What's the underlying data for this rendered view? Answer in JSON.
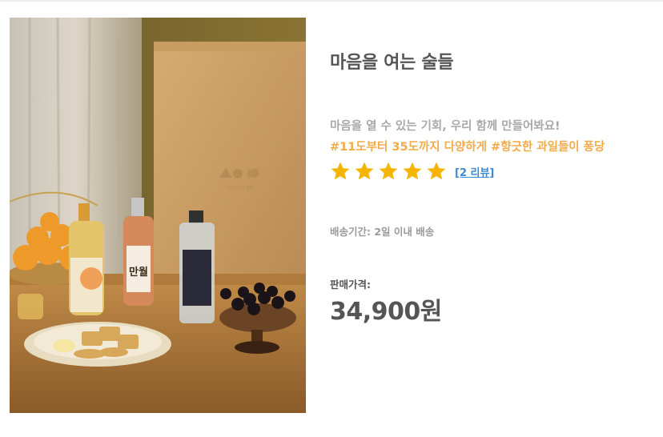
{
  "product": {
    "image_alt": "마음을 여는 술들",
    "box_logo_text": "마음을 여는 술들",
    "bottle_label": "만월",
    "title": "마음을 여는 술들",
    "subtitle": "마음을 열 수 있는 기회, 우리 함께 만들어봐요!",
    "hashtags": "#11도부터 35도까지 다양하게 #향긋한 과일들이 퐁당",
    "rating": {
      "stars": 5,
      "max": 5,
      "review_link": "[2 리뷰]"
    },
    "shipping": "배송기간: 2일 이내 배송",
    "price_label": "판매가격:",
    "price": "34,900원"
  },
  "colors": {
    "star": "#f4b400",
    "hashtag": "#f2ab48",
    "link": "#3a8ad8",
    "text_dark": "#555555",
    "text_muted": "#a8a8a8"
  }
}
